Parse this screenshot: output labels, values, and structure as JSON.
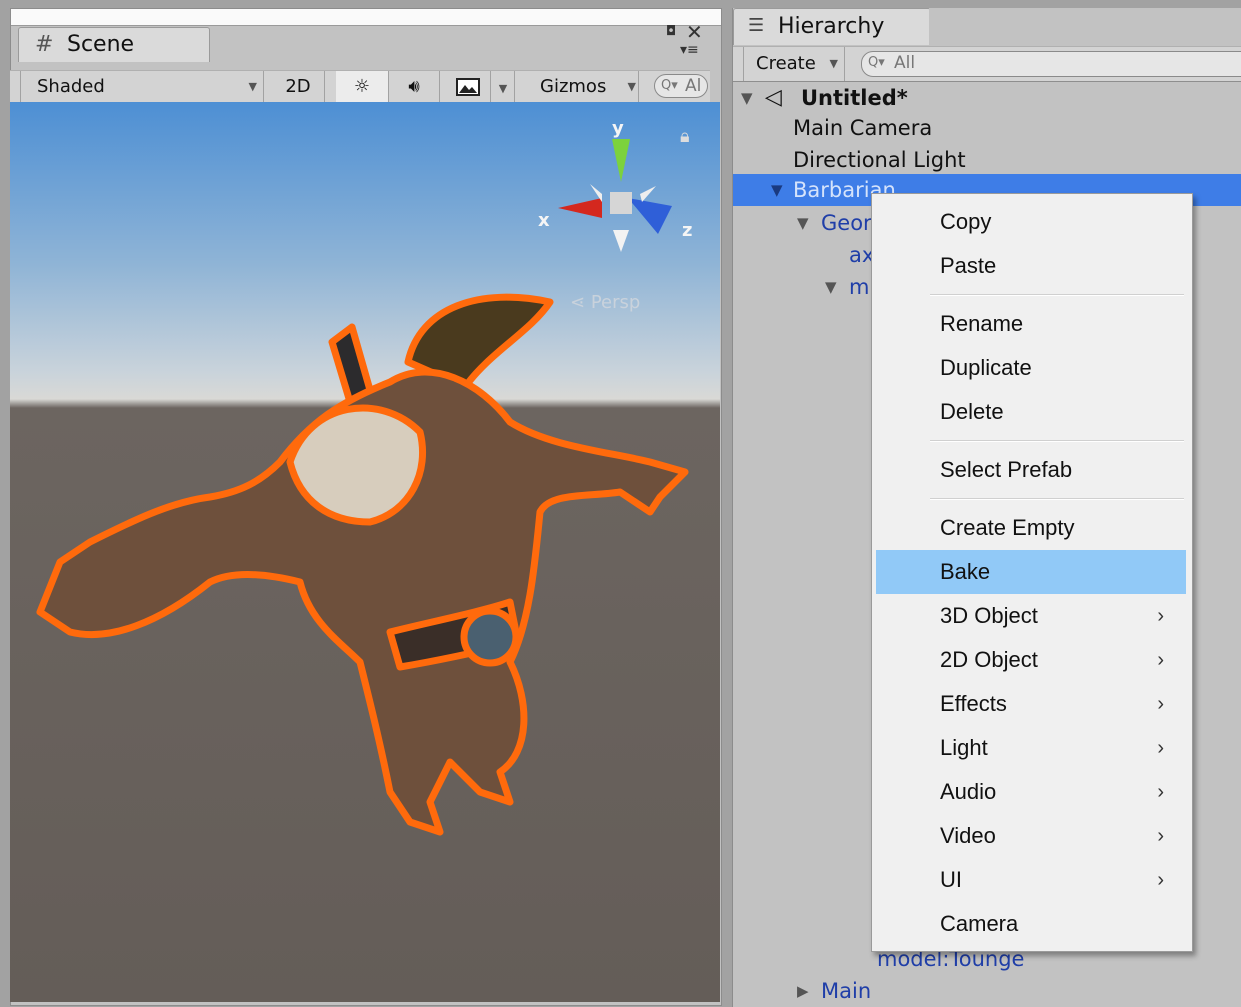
{
  "scene": {
    "tab_label": "Scene",
    "toolbar": {
      "shading_mode": "Shaded",
      "mode_2d": "2D",
      "gizmos": "Gizmos",
      "search": "Al"
    },
    "gizmo_axes": {
      "y": "y",
      "x": "x",
      "z": "z"
    },
    "camera_projection_label": "Persp"
  },
  "hierarchy": {
    "tab_label": "Hierarchy",
    "create_label": "Create",
    "search": "All",
    "scene_name": "Untitled*",
    "rows": [
      {
        "label": "Main Camera"
      },
      {
        "label": "Directional Light"
      },
      {
        "label": "Barbarian"
      },
      {
        "label": "Geor"
      },
      {
        "label": "ax"
      },
      {
        "label": "m"
      },
      {
        "label": "model:Tounge"
      },
      {
        "label": "Main"
      }
    ]
  },
  "context_menu": {
    "items": [
      {
        "label": "Copy"
      },
      {
        "label": "Paste"
      },
      {
        "label": "Rename"
      },
      {
        "label": "Duplicate"
      },
      {
        "label": "Delete"
      },
      {
        "label": "Select Prefab"
      },
      {
        "label": "Create Empty"
      },
      {
        "label": "Bake"
      },
      {
        "label": "3D Object"
      },
      {
        "label": "2D Object"
      },
      {
        "label": "Effects"
      },
      {
        "label": "Light"
      },
      {
        "label": "Audio"
      },
      {
        "label": "Video"
      },
      {
        "label": "UI"
      },
      {
        "label": "Camera"
      }
    ],
    "highlighted_item": "Bake",
    "colors": {
      "highlight": "#91c9f7",
      "selection": "#3e7de7"
    }
  }
}
